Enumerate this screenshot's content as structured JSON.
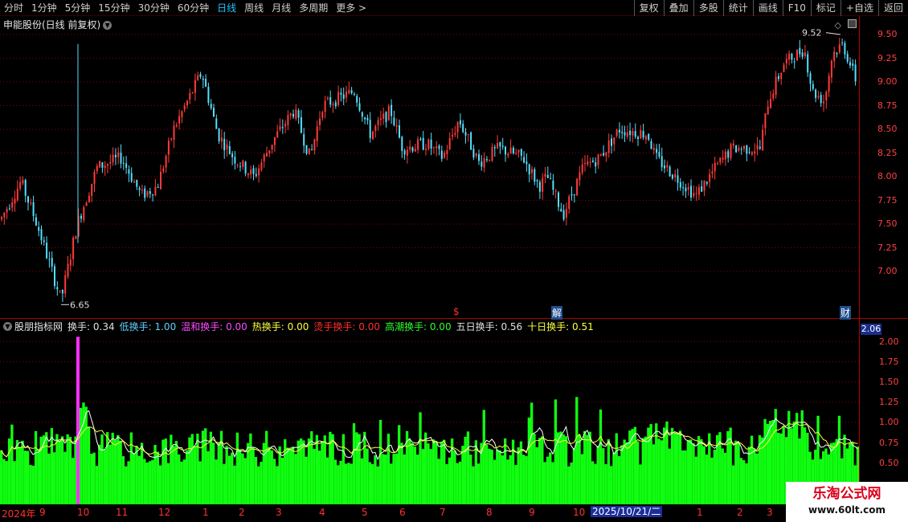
{
  "toolbar": {
    "periods": [
      "分时",
      "1分钟",
      "5分钟",
      "15分钟",
      "30分钟",
      "60分钟",
      "日线",
      "周线",
      "月线",
      "多周期",
      "更多 >"
    ],
    "active_period": "日线",
    "right_buttons": [
      "复权",
      "叠加",
      "多股",
      "统计",
      "画线",
      "F10",
      "标记",
      "+自选",
      "返回"
    ]
  },
  "main": {
    "title": "申能股份(日线 前复权)",
    "price_axis": [
      "9.50",
      "9.25",
      "9.00",
      "8.75",
      "8.50",
      "8.25",
      "8.00",
      "7.75",
      "7.50",
      "7.25",
      "7.00"
    ],
    "high_label": "9.52",
    "low_label": "6.65",
    "markers": {
      "s": "$",
      "jie": "解",
      "cai": "财"
    }
  },
  "indicator": {
    "name": "股朋指标网",
    "items": [
      {
        "label": "换手:",
        "value": "0.34",
        "color": "#e0e0e0"
      },
      {
        "label": "低换手:",
        "value": "1.00",
        "color": "#5fd0ff"
      },
      {
        "label": "温和换手:",
        "value": "0.00",
        "color": "#ff4bff"
      },
      {
        "label": "热换手:",
        "value": "0.00",
        "color": "#ffff40"
      },
      {
        "label": "烫手换手:",
        "value": "0.00",
        "color": "#ff3030"
      },
      {
        "label": "高潮换手:",
        "value": "0.00",
        "color": "#30ff30"
      },
      {
        "label": "五日换手:",
        "value": "0.56",
        "color": "#e0e0e0"
      },
      {
        "label": "十日换手:",
        "value": "0.51",
        "color": "#ffff40"
      }
    ],
    "badge": "2.06",
    "axis": [
      "2.00",
      "1.75",
      "1.50",
      "1.25",
      "1.00",
      "0.75",
      "0.50"
    ]
  },
  "date_axis": {
    "labels": [
      "2024年",
      "9",
      "10",
      "11",
      "12",
      "1",
      "2",
      "3",
      "4",
      "5",
      "6",
      "7",
      "8",
      "9",
      "10",
      "2025/10/21/二",
      "1",
      "2",
      "3"
    ],
    "cursor_date": "2025/10/21/二"
  },
  "watermark": {
    "title": "乐淘公式网",
    "url": "www.60lt.com"
  },
  "colors": {
    "up": "#ff3b3b",
    "down": "#54e0ff",
    "volume": "#10ff10",
    "spike": "#ff30ff",
    "axis": "#ff4040"
  }
}
